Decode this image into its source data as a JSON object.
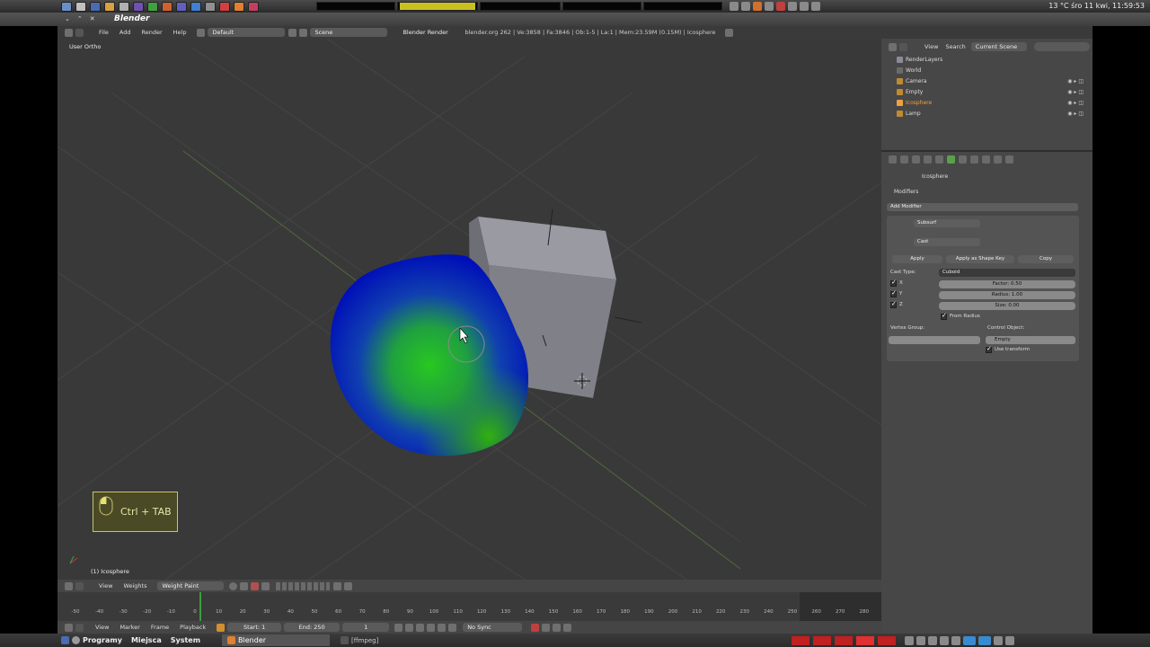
{
  "os_top": {
    "clock": "13 °C  śro 11 kwi, 11:59:53"
  },
  "window": {
    "title": "Blender"
  },
  "info_header": {
    "menus": [
      "File",
      "Add",
      "Render",
      "Help"
    ],
    "screen_layout": "Default",
    "scene": "Scene",
    "render_engine": "Blender Render",
    "stats": "blender.org 262 | Ve:3858 | Fa:3846 | Ob:1-5 | La:1 | Mem:23.59M (0.15M) | Icosphere"
  },
  "viewport": {
    "view_label": "User Ortho",
    "object_label": "(1) Icosphere",
    "shortcut_hint": "Ctrl + TAB",
    "colors": {
      "background": "#393939",
      "grid": "#4a4a4a",
      "weight_low": "#0000c8",
      "weight_high": "#18c018"
    }
  },
  "viewport_header": {
    "menus": [
      "View",
      "Weights"
    ],
    "mode": "Weight Paint"
  },
  "timeline": {
    "ticks": [
      "-50",
      "-40",
      "-30",
      "-20",
      "-10",
      "0",
      "10",
      "20",
      "30",
      "40",
      "50",
      "60",
      "70",
      "80",
      "90",
      "100",
      "110",
      "120",
      "130",
      "140",
      "150",
      "160",
      "170",
      "180",
      "190",
      "200",
      "210",
      "220",
      "230",
      "240",
      "250",
      "260",
      "270",
      "280"
    ],
    "menus": [
      "View",
      "Marker",
      "Frame",
      "Playback"
    ],
    "start": "Start: 1",
    "end": "End: 250",
    "current": "1",
    "sync": "No Sync"
  },
  "outliner": {
    "menus": [
      "View",
      "Search"
    ],
    "filter": "Current Scene",
    "items": [
      {
        "label": "RenderLayers",
        "color": "#8a8a9a"
      },
      {
        "label": "World",
        "color": "#6a6a6a"
      },
      {
        "label": "Camera",
        "color": "#c08a30"
      },
      {
        "label": "Empty",
        "color": "#c08a30"
      },
      {
        "label": "Icosphere",
        "color": "#f0a040"
      },
      {
        "label": "Lamp",
        "color": "#c08a30"
      }
    ]
  },
  "properties": {
    "context_object": "Icosphere",
    "panel_title": "Modifiers",
    "add_modifier": "Add Modifier",
    "modifiers": [
      {
        "name": "Subsurf"
      },
      {
        "name": "Cast"
      }
    ],
    "apply": "Apply",
    "apply_shape": "Apply as Shape Key",
    "copy": "Copy",
    "cast_type_label": "Cast Type:",
    "cast_type": "Cuboid",
    "axis_x": "X",
    "axis_y": "Y",
    "axis_z": "Z",
    "factor": "Factor: 0.50",
    "radius": "Radius: 1.00",
    "size": "Size: 0.00",
    "from_radius": "From Radius",
    "vertex_group_label": "Vertex Group:",
    "control_object_label": "Control Object:",
    "control_object": "Empty",
    "use_transform": "Use transform"
  },
  "taskbar": {
    "menus": [
      "Programy",
      "Miejsca",
      "System"
    ],
    "blender_task": "Blender",
    "ffmpeg_task": "[ffmpeg]"
  }
}
